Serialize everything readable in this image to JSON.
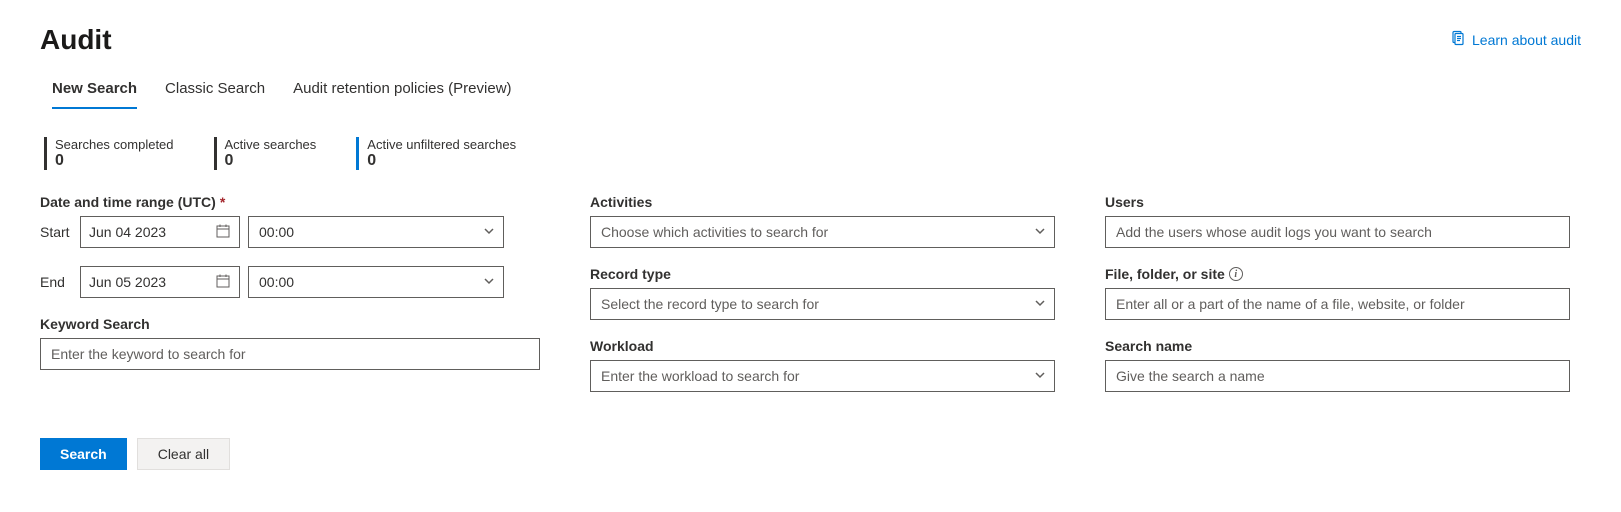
{
  "header": {
    "title": "Audit",
    "learn_link": "Learn about audit"
  },
  "tabs": {
    "new_search": "New Search",
    "classic_search": "Classic Search",
    "retention": "Audit retention policies (Preview)"
  },
  "stats": {
    "completed_label": "Searches completed",
    "completed_value": "0",
    "active_label": "Active searches",
    "active_value": "0",
    "unfiltered_label": "Active unfiltered searches",
    "unfiltered_value": "0"
  },
  "form": {
    "date_range_label": "Date and time range (UTC)",
    "start_label": "Start",
    "start_date": "Jun 04 2023",
    "start_time": "00:00",
    "end_label": "End",
    "end_date": "Jun 05 2023",
    "end_time": "00:00",
    "keyword_label": "Keyword Search",
    "keyword_placeholder": "Enter the keyword to search for",
    "activities_label": "Activities",
    "activities_placeholder": "Choose which activities to search for",
    "record_type_label": "Record type",
    "record_type_placeholder": "Select the record type to search for",
    "workload_label": "Workload",
    "workload_placeholder": "Enter the workload to search for",
    "users_label": "Users",
    "users_placeholder": "Add the users whose audit logs you want to search",
    "file_label": "File, folder, or site",
    "file_placeholder": "Enter all or a part of the name of a file, website, or folder",
    "search_name_label": "Search name",
    "search_name_placeholder": "Give the search a name"
  },
  "actions": {
    "search": "Search",
    "clear": "Clear all"
  }
}
